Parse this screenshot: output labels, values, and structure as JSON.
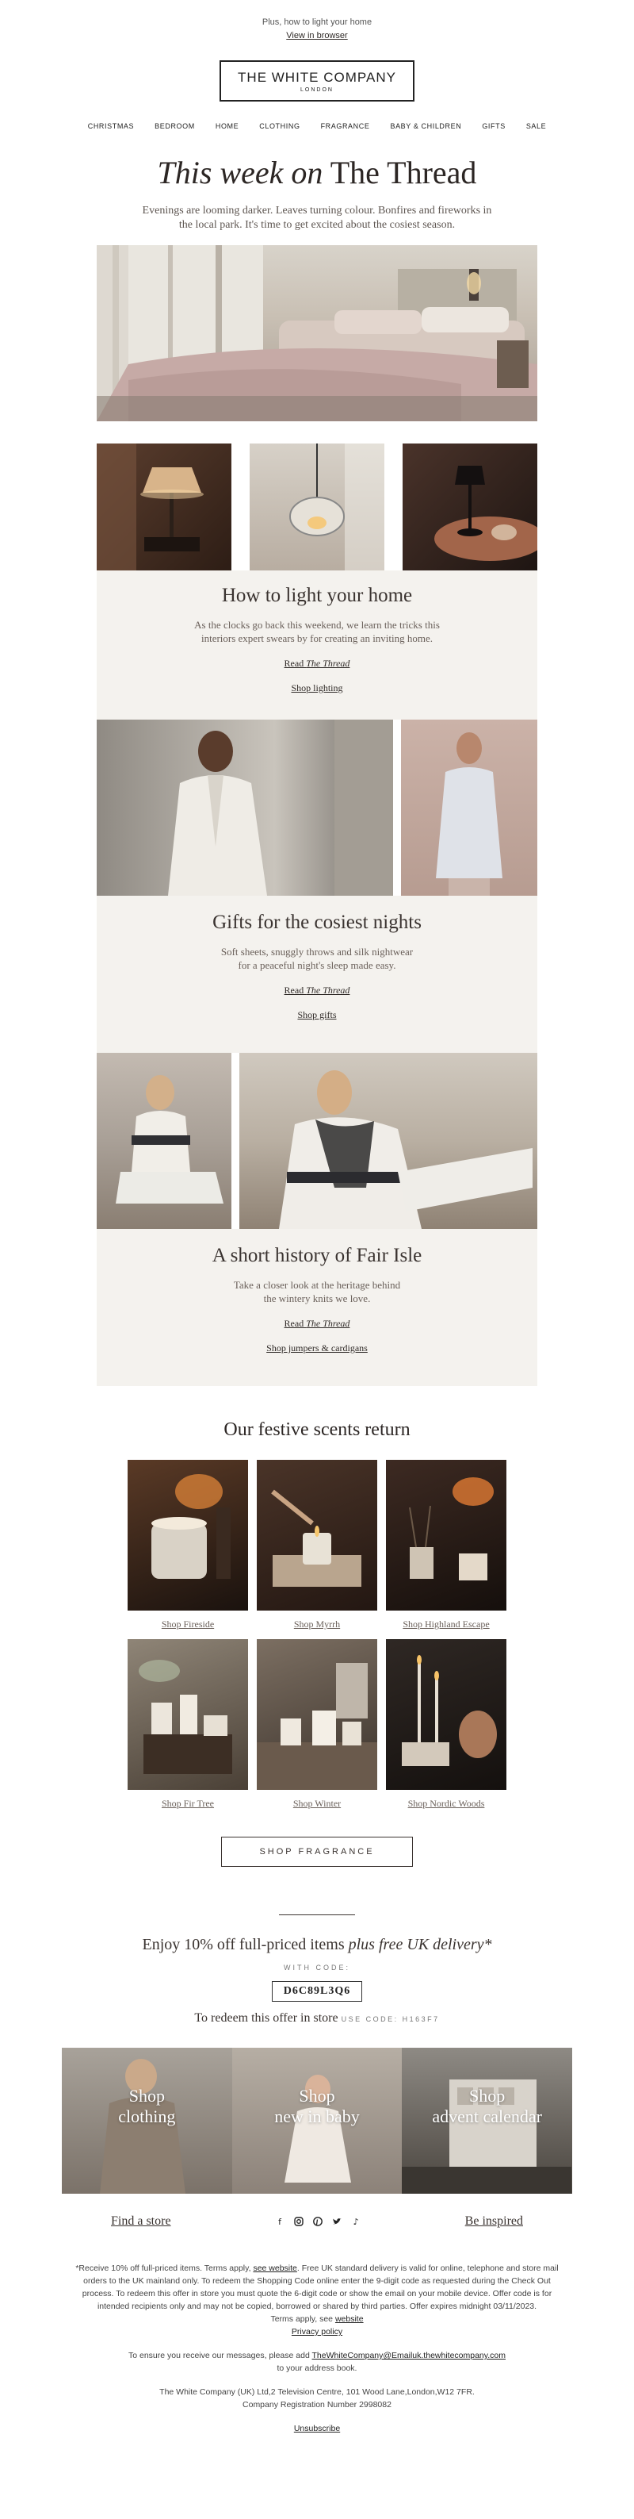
{
  "preheader": {
    "text": "Plus, how to light your home",
    "view_in_browser": "View in browser"
  },
  "logo": {
    "line1": "THE WHITE COMPANY",
    "line2": "LONDON"
  },
  "nav": [
    "CHRISTMAS",
    "BEDROOM",
    "HOME",
    "CLOTHING",
    "FRAGRANCE",
    "BABY & CHILDREN",
    "GIFTS",
    "SALE"
  ],
  "hero": {
    "title_italic": "This week on",
    "title_rest": " The Thread",
    "intro": "Evenings are looming darker. Leaves turning colour. Bonfires and fireworks in the local park. It's time to get excited about the cosiest season."
  },
  "stories": [
    {
      "title": "How to light your home",
      "body": "As the clocks go back this weekend, we learn the tricks this interiors expert swears by for creating an inviting home.",
      "read_prefix": "Read ",
      "read_italic": "The Thread",
      "shop": "Shop lighting"
    },
    {
      "title": "Gifts for the cosiest nights",
      "body": "Soft sheets, snuggly throws and silk nightwear for a peaceful night's sleep made easy.",
      "read_prefix": "Read ",
      "read_italic": "The Thread",
      "shop": "Shop gifts"
    },
    {
      "title": "A short history of Fair Isle",
      "body": "Take a closer look at the heritage behind the wintery knits we love.",
      "read_prefix": "Read ",
      "read_italic": "The Thread",
      "shop": "Shop jumpers & cardigans"
    }
  ],
  "scents": {
    "title": "Our festive scents return",
    "items": [
      "Shop Fireside",
      "Shop Myrrh",
      "Shop Highland Escape",
      "Shop Fir Tree",
      "Shop Winter",
      "Shop Nordic Woods"
    ],
    "button": "SHOP FRAGRANCE"
  },
  "offer": {
    "text": "Enjoy 10% off full-priced items ",
    "text_italic": "plus free UK delivery*",
    "with_code": "WITH CODE:",
    "code": "D6C89L3Q6",
    "store_text": "To redeem this offer in store ",
    "store_code": "USE CODE: H163F7"
  },
  "tiles": [
    {
      "line1": "Shop",
      "line2": "clothing"
    },
    {
      "line1": "Shop",
      "line2": "new in baby"
    },
    {
      "line1": "Shop",
      "line2": "advent calendar"
    }
  ],
  "footer_nav": {
    "find_store": "Find a store",
    "be_inspired": "Be inspired"
  },
  "social_icons": [
    "facebook-icon",
    "instagram-icon",
    "pinterest-icon",
    "twitter-icon",
    "tiktok-icon"
  ],
  "legal": {
    "p1_a": "*Receive 10% off full-priced items. Terms apply, ",
    "p1_link": "see website",
    "p1_b": ". Free UK standard delivery is valid for online, telephone and store mail orders to the UK mainland only. To redeem the Shopping Code online enter the 9-digit code as requested during the Check Out process. To redeem this offer in store you must quote the 6-digit code or show the email on your mobile device. Offer code is for intended recipients only and may not be copied, borrowed or shared by third parties. Offer expires midnight 03/11/2023.",
    "terms_a": "Terms apply, see ",
    "terms_link": "website",
    "privacy": "Privacy policy",
    "ensure_a": "To ensure you receive our messages, please add ",
    "ensure_link": "TheWhiteCompany@Emailuk.thewhitecompany.com",
    "ensure_b": "to your address book.",
    "address": "The White Company (UK) Ltd,2 Television Centre, 101 Wood Lane,London,W12 7FR.",
    "registration": "Company Registration Number 2998082",
    "unsubscribe": "Unsubscribe"
  }
}
